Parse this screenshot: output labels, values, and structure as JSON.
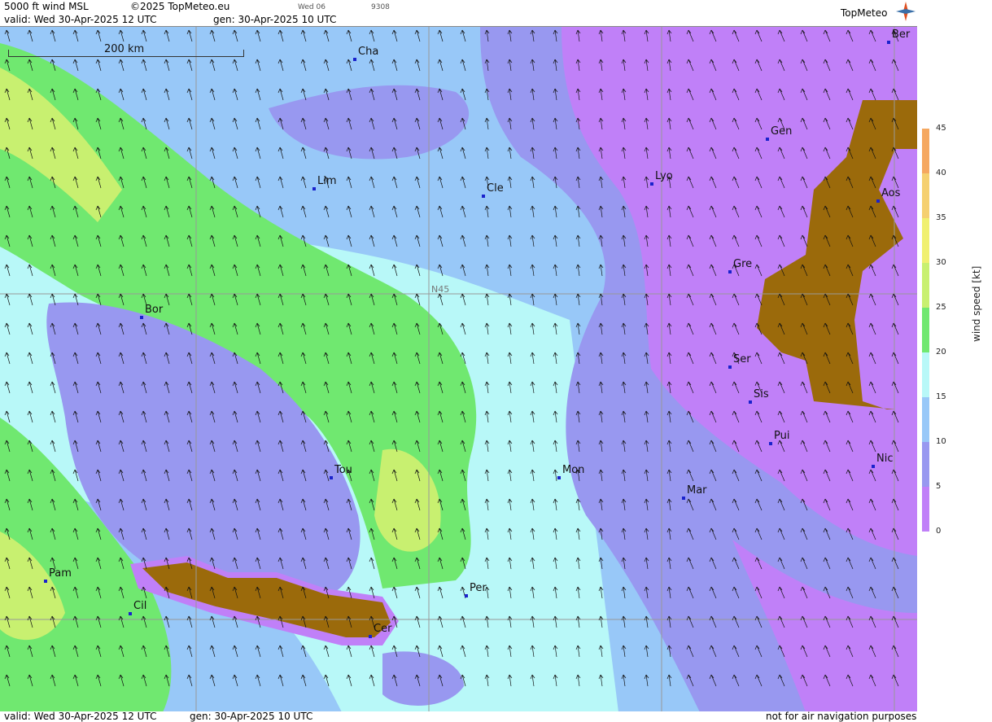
{
  "header": {
    "product": "5000 ft wind MSL",
    "copyright": "©2025 TopMeteo.eu",
    "run_small_a": "Wed 06",
    "run_small_b": "9308",
    "valid": "valid:  Wed  30-Apr-2025  12 UTC",
    "gen": "gen: 30-Apr-2025 10 UTC",
    "logo": "TopMeteo"
  },
  "footer": {
    "valid": "valid:  Wed  30-Apr-2025  12 UTC",
    "gen": "gen: 30-Apr-2025 10 UTC",
    "disclaimer": "not for air navigation purposes"
  },
  "map": {
    "scale_label": "200 km",
    "grid_label": "N45",
    "cities": [
      {
        "label": "Cha"
      },
      {
        "label": "Ber"
      },
      {
        "label": "Gen"
      },
      {
        "label": "Lim"
      },
      {
        "label": "Cle"
      },
      {
        "label": "Lyo"
      },
      {
        "label": "Aos"
      },
      {
        "label": "Gre"
      },
      {
        "label": "Bor"
      },
      {
        "label": "Ser"
      },
      {
        "label": "Sis"
      },
      {
        "label": "Pui"
      },
      {
        "label": "Nic"
      },
      {
        "label": "Tou"
      },
      {
        "label": "Mon"
      },
      {
        "label": "Mar"
      },
      {
        "label": "Pam"
      },
      {
        "label": "Per"
      },
      {
        "label": "Cil"
      },
      {
        "label": "Cer"
      }
    ]
  },
  "legend": {
    "title": "wind speed [kt]",
    "ticks": [
      "45",
      "40",
      "35",
      "30",
      "25",
      "20",
      "15",
      "10",
      "5",
      "0"
    ],
    "colors": [
      "#f08070",
      "#f5a860",
      "#f5d070",
      "#f0f070",
      "#c8f070",
      "#70e870",
      "#b8f8f8",
      "#98c8f8",
      "#9898f0",
      "#c080f8"
    ],
    "orography_color": "#9b6a0b"
  }
}
